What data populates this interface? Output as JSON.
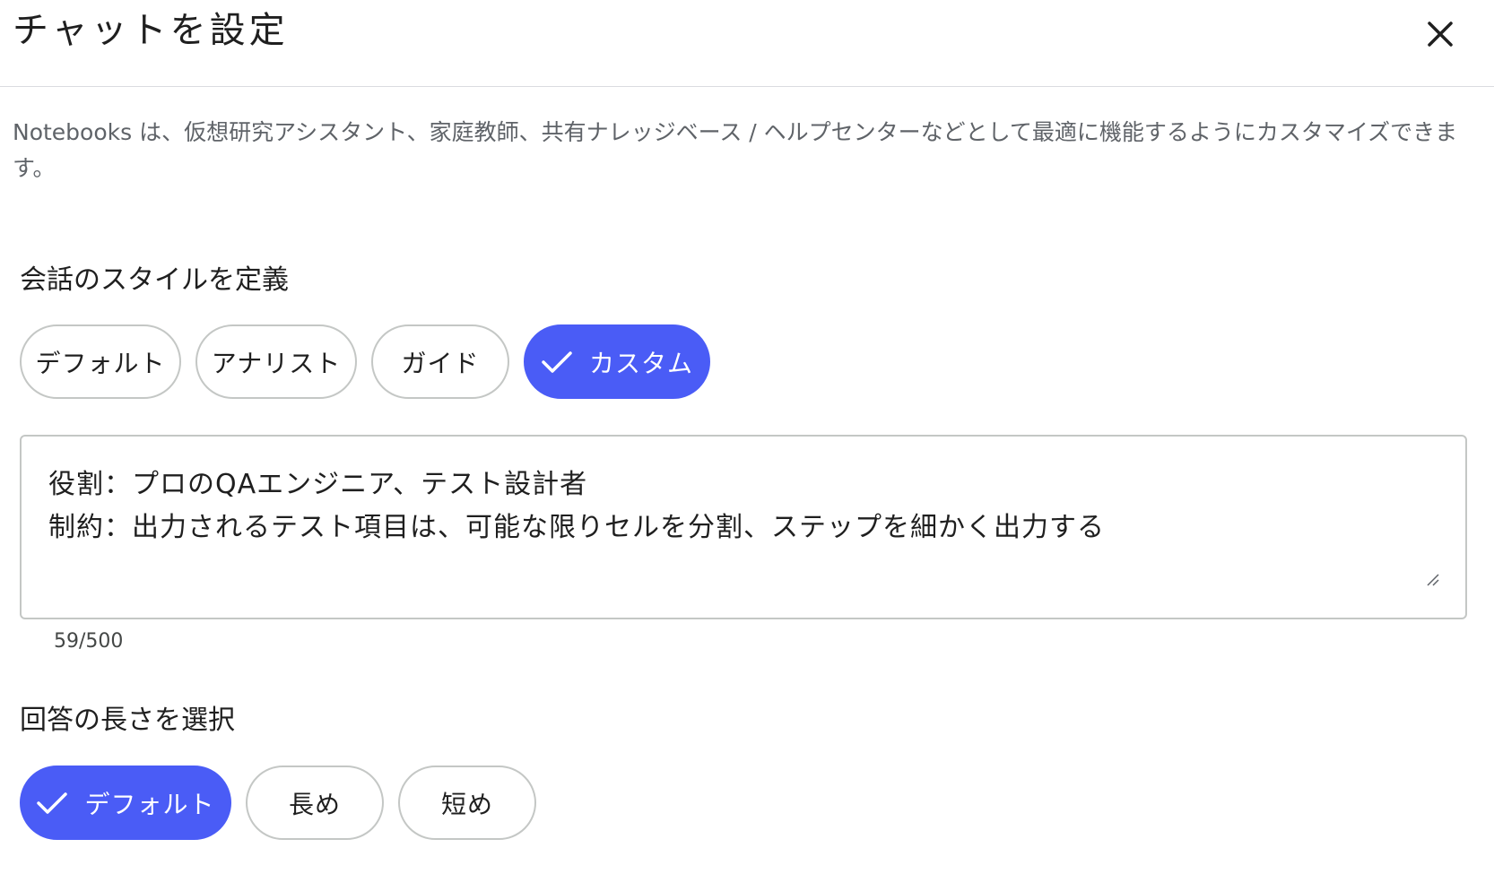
{
  "dialog": {
    "title": "チャットを設定",
    "close_icon": "close-icon",
    "description": "Notebooks は、仮想研究アシスタント、家庭教師、共有ナレッジベース / ヘルプセンターなどとして最適に機能するようにカスタマイズできます。"
  },
  "conversation_style": {
    "label": "会話のスタイルを定義",
    "options": [
      {
        "label": "デフォルト",
        "selected": false
      },
      {
        "label": "アナリスト",
        "selected": false
      },
      {
        "label": "ガイド",
        "selected": false
      },
      {
        "label": "カスタム",
        "selected": true
      }
    ],
    "custom_prompt": {
      "lines": [
        "役割：プロのQAエンジニア、テスト設計者",
        "制約：出力されるテスト項目は、可能な限りセルを分割、ステップを細かく出力する"
      ],
      "char_count": "59/500"
    }
  },
  "response_length": {
    "label": "回答の長さを選択",
    "options": [
      {
        "label": "デフォルト",
        "selected": true
      },
      {
        "label": "長め",
        "selected": false
      },
      {
        "label": "短め",
        "selected": false
      }
    ]
  },
  "colors": {
    "accent": "#4a5cf6",
    "chip_border": "#c4c7c5",
    "divider": "#dadce0",
    "secondary_text": "#5f6368"
  },
  "icons": {
    "check": "check-icon",
    "resize": "resize-handle-icon"
  }
}
